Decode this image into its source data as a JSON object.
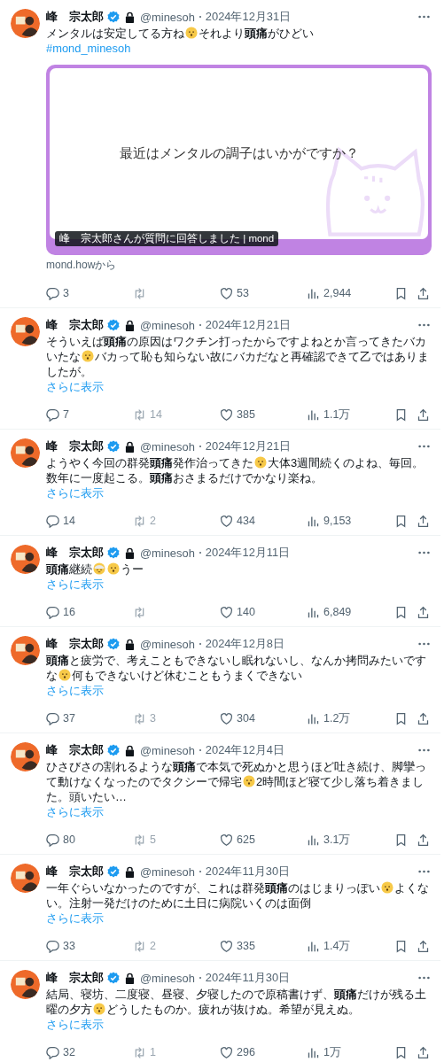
{
  "tweets": [
    {
      "name": "峰　宗太郎",
      "verified": true,
      "protected": true,
      "handle": "@minesoh",
      "date": "2024年12月31日",
      "body": [
        {
          "kind": "text",
          "t": "メンタルは安定してる方ね"
        },
        {
          "kind": "face"
        },
        {
          "kind": "text",
          "t": "それより**頭痛**がひどい"
        }
      ],
      "hashtag": "#mond_minesoh",
      "card": {
        "question": "最近はメンタルの調子はいかがですか？",
        "caption": "峰　宗太郎さんが質問に回答しました | mond",
        "source": "mond.howから"
      },
      "stats": {
        "replies": "3",
        "likes": "53",
        "views": "2,944"
      }
    },
    {
      "name": "峰　宗太郎",
      "verified": true,
      "protected": true,
      "handle": "@minesoh",
      "date": "2024年12月21日",
      "body": [
        {
          "kind": "text",
          "t": "そういえば**頭痛**の原因はワクチン打ったからですよねとか言ってきたバカいたな"
        },
        {
          "kind": "face"
        },
        {
          "kind": "text",
          "t": "バカって恥も知らない故にバカだなと再確認できて乙ではありましたが。"
        }
      ],
      "show_more": "さらに表示",
      "stats": {
        "replies": "7",
        "retweets": "14",
        "likes": "385",
        "views": "1.1万"
      }
    },
    {
      "name": "峰　宗太郎",
      "verified": true,
      "protected": true,
      "handle": "@minesoh",
      "date": "2024年12月21日",
      "body": [
        {
          "kind": "text",
          "t": "ようやく今回の群発**頭痛**発作治ってきた"
        },
        {
          "kind": "face"
        },
        {
          "kind": "text",
          "t": "大体3週間続くのよね、毎回。数年に一度起こる。**頭痛**おさまるだけでかなり楽ね。"
        }
      ],
      "show_more": "さらに表示",
      "stats": {
        "replies": "14",
        "retweets": "2",
        "likes": "434",
        "views": "9,153"
      }
    },
    {
      "name": "峰　宗太郎",
      "verified": true,
      "protected": true,
      "handle": "@minesoh",
      "date": "2024年12月11日",
      "body": [
        {
          "kind": "text",
          "t": "**頭痛**継続"
        },
        {
          "kind": "sleepy_face"
        },
        {
          "kind": "face"
        },
        {
          "kind": "text",
          "t": "うー"
        }
      ],
      "show_more": "さらに表示",
      "stats": {
        "replies": "16",
        "likes": "140",
        "views": "6,849"
      }
    },
    {
      "name": "峰　宗太郎",
      "verified": true,
      "protected": true,
      "handle": "@minesoh",
      "date": "2024年12月8日",
      "body": [
        {
          "kind": "text",
          "t": "**頭痛**と疲労で、考えこともできないし眠れないし、なんか拷問みたいですな"
        },
        {
          "kind": "face"
        },
        {
          "kind": "text",
          "t": "何もできないけど休むこともうまくできない"
        }
      ],
      "show_more": "さらに表示",
      "stats": {
        "replies": "37",
        "retweets": "3",
        "likes": "304",
        "views": "1.2万"
      }
    },
    {
      "name": "峰　宗太郎",
      "verified": true,
      "protected": true,
      "handle": "@minesoh",
      "date": "2024年12月4日",
      "body": [
        {
          "kind": "text",
          "t": "ひさびさの割れるような**頭痛**で本気で死ぬかと思うほど吐き続け、脚攣って動けなくなったのでタクシーで帰宅"
        },
        {
          "kind": "face"
        },
        {
          "kind": "text",
          "t": "2時間ほど寝て少し落ち着きました。頭いたい…"
        }
      ],
      "show_more": "さらに表示",
      "stats": {
        "replies": "80",
        "retweets": "5",
        "likes": "625",
        "views": "3.1万"
      }
    },
    {
      "name": "峰　宗太郎",
      "verified": true,
      "protected": true,
      "handle": "@minesoh",
      "date": "2024年11月30日",
      "body": [
        {
          "kind": "text",
          "t": "一年ぐらいなかったのですが、これは群発**頭痛**のはじまりっぽい"
        },
        {
          "kind": "face"
        },
        {
          "kind": "text",
          "t": "よくない。注射一発だけのために土日に病院いくのは面倒"
        }
      ],
      "show_more": "さらに表示",
      "stats": {
        "replies": "33",
        "retweets": "2",
        "likes": "335",
        "views": "1.4万"
      }
    },
    {
      "name": "峰　宗太郎",
      "verified": true,
      "protected": true,
      "handle": "@minesoh",
      "date": "2024年11月30日",
      "body": [
        {
          "kind": "text",
          "t": "結局、寝坊、二度寝、昼寝、夕寝したので原稿書けず、**頭痛**だけが残る土曜の夕方"
        },
        {
          "kind": "face"
        },
        {
          "kind": "text",
          "t": "どうしたものか。疲れが抜けぬ。希望が見えぬ。"
        }
      ],
      "show_more": "さらに表示",
      "stats": {
        "replies": "32",
        "retweets": "1",
        "likes": "296",
        "views": "1万"
      }
    }
  ]
}
